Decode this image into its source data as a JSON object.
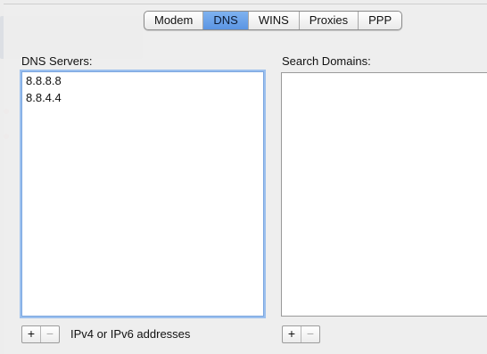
{
  "tabs": [
    {
      "label": "Modem",
      "active": false
    },
    {
      "label": "DNS",
      "active": true
    },
    {
      "label": "WINS",
      "active": false
    },
    {
      "label": "Proxies",
      "active": false
    },
    {
      "label": "PPP",
      "active": false
    }
  ],
  "dns": {
    "label": "DNS Servers:",
    "servers": [
      "8.8.8.8",
      "8.8.4.4"
    ],
    "add_label": "+",
    "remove_label": "−",
    "hint": "IPv4 or IPv6 addresses"
  },
  "search": {
    "label": "Search Domains:",
    "domains": [],
    "add_label": "+",
    "remove_label": "−"
  },
  "colors": {
    "active_tab": "#6aa3ea",
    "focus_ring": "#9cc0ee"
  }
}
